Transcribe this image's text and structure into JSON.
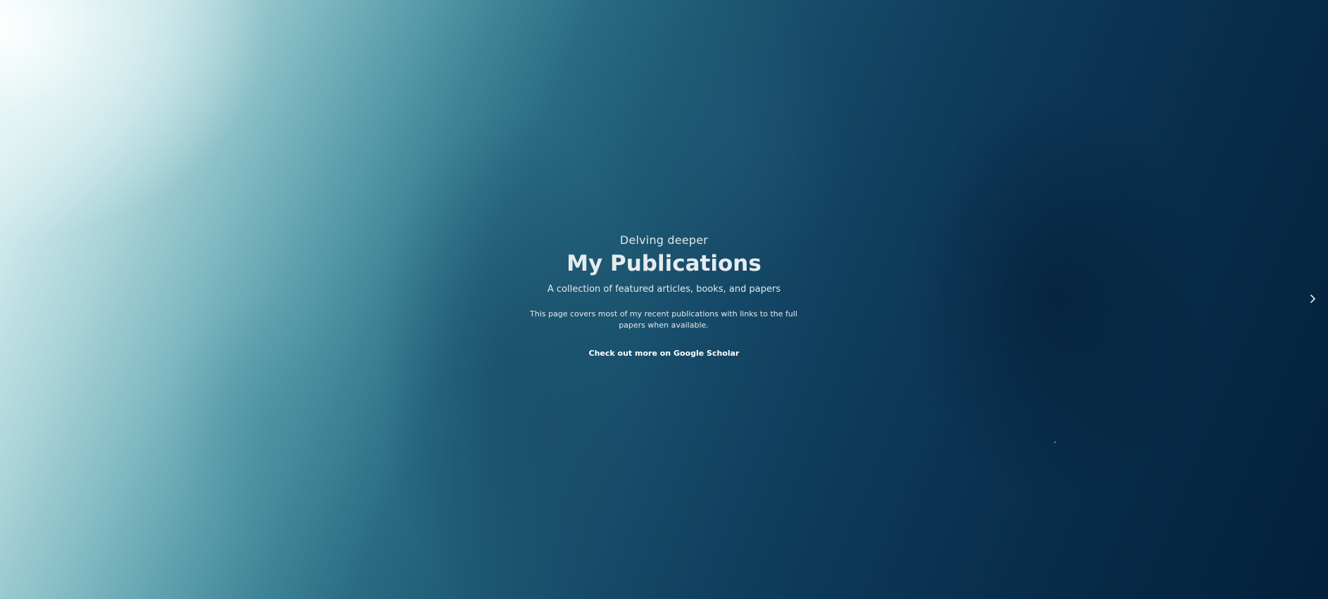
{
  "hero": {
    "eyebrow": "Delving deeper",
    "title": "My Publications",
    "subtitle": "A collection of featured articles, books, and papers",
    "description": "This page covers most of my recent publications with links to the full papers when available.",
    "scholar_link": "Check out more on Google Scholar"
  },
  "navigation": {
    "next_icon": "chevron-right-icon"
  },
  "colors": {
    "text": "#e6ebee",
    "bg_dark": "#04203a",
    "bg_light": "#f3fbfb"
  }
}
